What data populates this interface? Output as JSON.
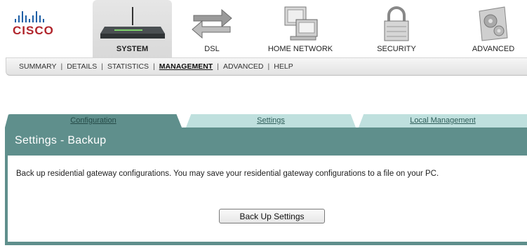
{
  "brand": {
    "logo_text": "CISCO"
  },
  "nav": {
    "items": [
      {
        "label": "SYSTEM",
        "icon": "router-icon"
      },
      {
        "label": "DSL",
        "icon": "exchange-arrows-icon"
      },
      {
        "label": "HOME NETWORK",
        "icon": "computers-icon"
      },
      {
        "label": "SECURITY",
        "icon": "padlock-icon"
      },
      {
        "label": "ADVANCED",
        "icon": "gears-icon"
      }
    ],
    "active": "SYSTEM"
  },
  "subnav": {
    "items": [
      "SUMMARY",
      "DETAILS",
      "STATISTICS",
      "MANAGEMENT",
      "ADVANCED",
      "HELP"
    ],
    "active": "MANAGEMENT"
  },
  "tabs": {
    "items": [
      "Configuration",
      "Settings",
      "Local Management"
    ],
    "active": "Configuration"
  },
  "panel": {
    "title": "Settings - Backup",
    "description": "Back up residential gateway configurations. You may save your residential gateway configurations to a file on your PC.",
    "button_label": "Back Up Settings"
  },
  "colors": {
    "panel_teal": "#5f8f8c",
    "tab_inactive": "#bfe0de",
    "cisco_red": "#b1252c",
    "cisco_blue": "#1d5fa6"
  }
}
